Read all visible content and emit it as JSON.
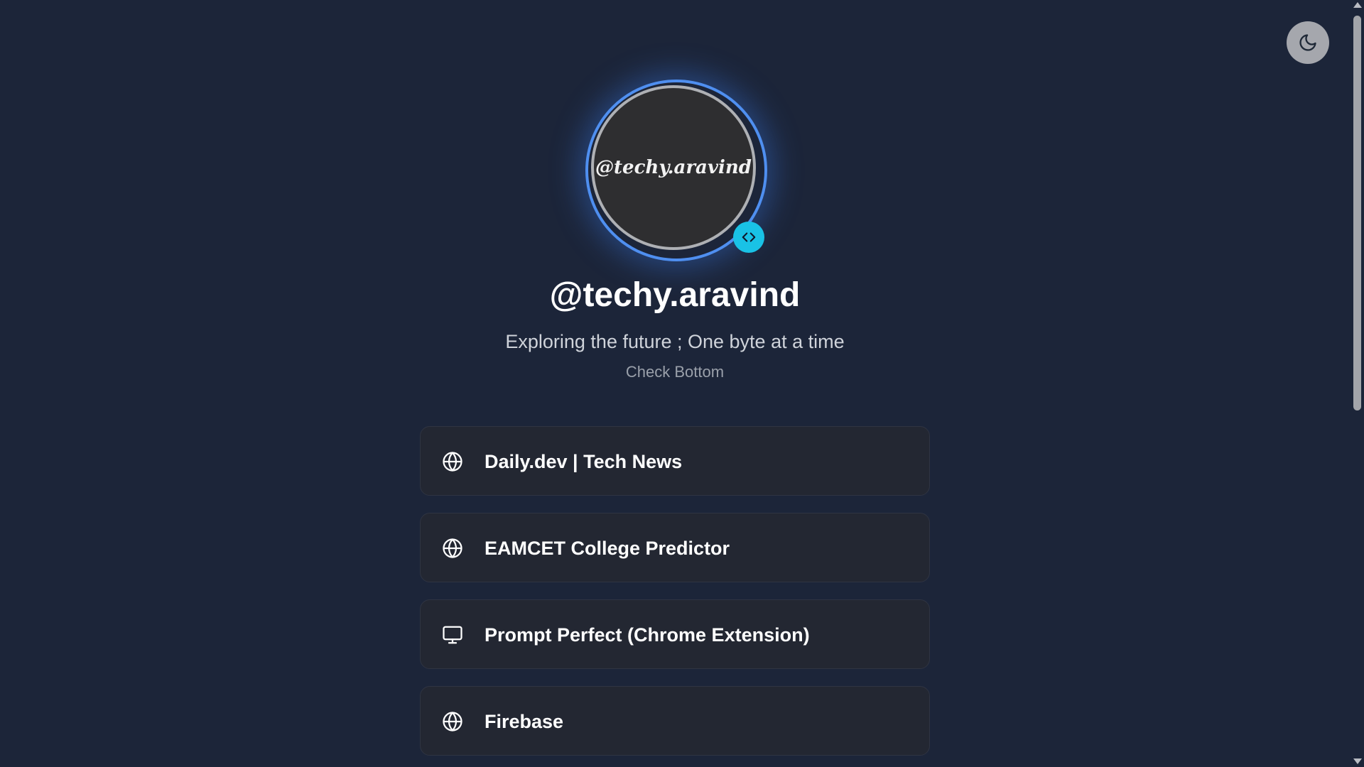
{
  "theme_toggle": {
    "icon": "moon-icon"
  },
  "profile": {
    "avatar_text": "@techy.aravind",
    "badge_icon": "code-icon",
    "name": "@techy.aravind",
    "bio": "Exploring the future ; One byte at a time",
    "subtitle": "Check Bottom"
  },
  "links": [
    {
      "label": "Daily.dev | Tech News",
      "icon": "globe-icon"
    },
    {
      "label": "EAMCET College Predictor",
      "icon": "globe-icon"
    },
    {
      "label": "Prompt Perfect (Chrome Extension)",
      "icon": "monitor-icon"
    },
    {
      "label": "Firebase",
      "icon": "globe-icon"
    }
  ],
  "colors": {
    "background": "#1c2539",
    "card": "#232732",
    "ring": "#4f8ff0",
    "badge": "#19c2e6",
    "toggle": "#a5a7ad"
  }
}
